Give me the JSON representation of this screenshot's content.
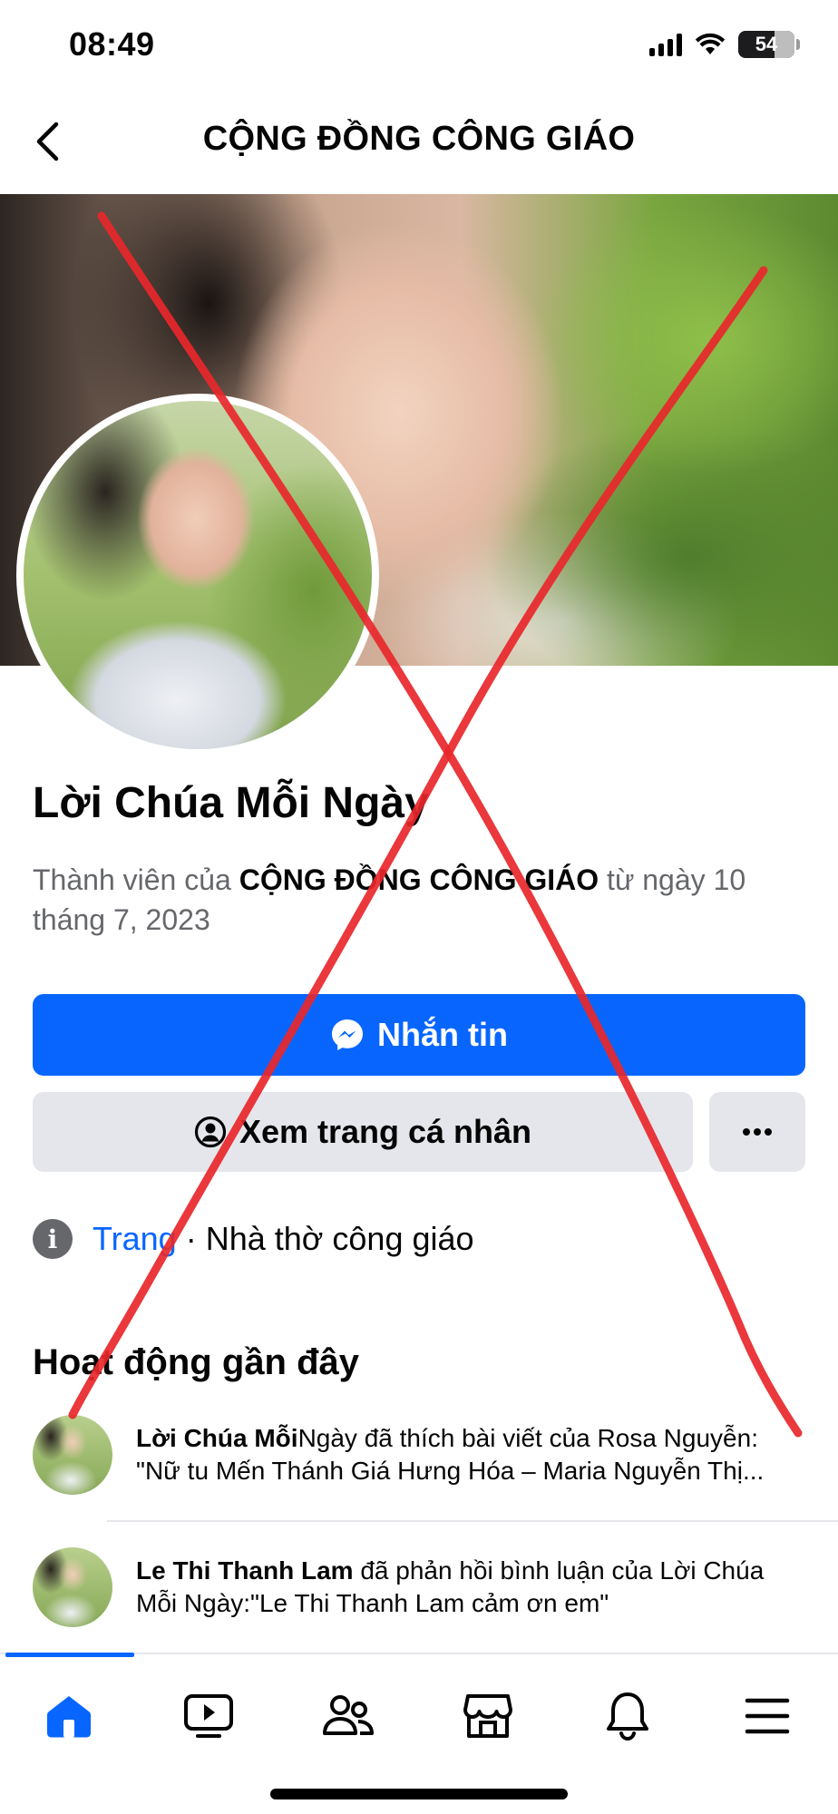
{
  "status_bar": {
    "time": "08:49",
    "battery": "54"
  },
  "header": {
    "title": "CỘNG ĐỒNG CÔNG GIÁO"
  },
  "profile": {
    "name": "Lời Chúa Mỗi Ngày",
    "member_prefix": "Thành viên của ",
    "member_group": "CỘNG ĐỒNG CÔNG GIÁO",
    "member_suffix": " từ ngày 10 tháng 7, 2023"
  },
  "actions": {
    "message_label": "Nhắn tin",
    "profile_label": "Xem trang cá nhân",
    "more_label": "···"
  },
  "info": {
    "type_link": "Trang",
    "separator": " · ",
    "category": "Nhà thờ công giáo"
  },
  "activity": {
    "title": "Hoạt động gần đây",
    "items": [
      {
        "actor": "Lời Chúa Mỗi",
        "line1_rest": "Ngày  đã thích bài viết của Rosa Nguyễn:",
        "line2": "\"Nữ tu Mến Thánh Giá Hưng Hóa – Maria Nguyễn Thị..."
      },
      {
        "actor": "Le Thi Thanh Lam",
        "line1_rest": " đã phản hồi bình luận của Lời Chúa",
        "line2": "Mỗi Ngày:\"Le Thi Thanh Lam cảm ơn em\""
      }
    ]
  },
  "tab_bar": {
    "tabs": [
      "home-icon",
      "video-icon",
      "friends-icon",
      "marketplace-icon",
      "bell-icon",
      "menu-icon"
    ],
    "active": "home-icon"
  },
  "colors": {
    "accent": "#0866ff",
    "overlay_cross": "#e8272b"
  }
}
